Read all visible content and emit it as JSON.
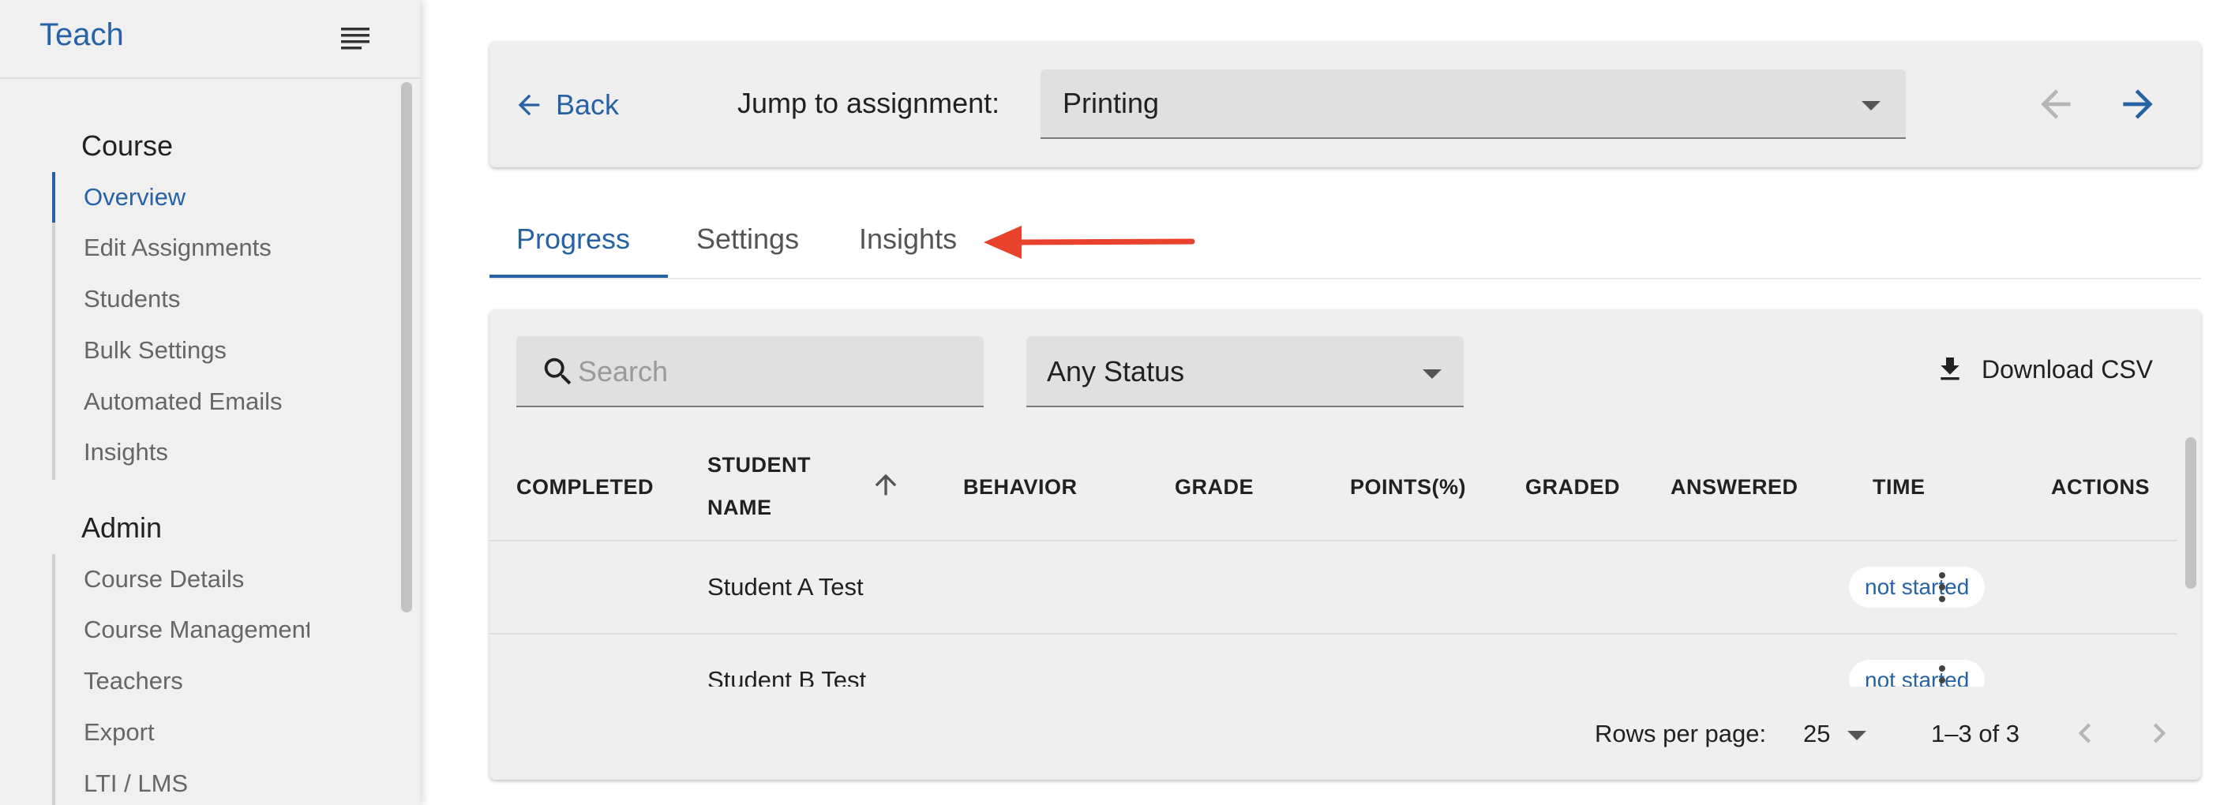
{
  "sidebar": {
    "brand": "Teach",
    "sections": [
      {
        "title": "Course",
        "items": [
          {
            "label": "Overview",
            "active": true
          },
          {
            "label": "Edit Assignments"
          },
          {
            "label": "Students"
          },
          {
            "label": "Bulk Settings"
          },
          {
            "label": "Automated Emails"
          },
          {
            "label": "Insights"
          }
        ]
      },
      {
        "title": "Admin",
        "items": [
          {
            "label": "Course Details"
          },
          {
            "label": "Course Management"
          },
          {
            "label": "Teachers"
          },
          {
            "label": "Export"
          },
          {
            "label": "LTI / LMS"
          }
        ]
      }
    ]
  },
  "topbar": {
    "back_label": "Back",
    "jump_label": "Jump to assignment:",
    "assignment_selected": "Printing"
  },
  "tabs": [
    {
      "label": "Progress",
      "active": true
    },
    {
      "label": "Settings"
    },
    {
      "label": "Insights"
    }
  ],
  "filters": {
    "search_placeholder": "Search",
    "search_value": "",
    "status_selected": "Any Status",
    "download_label": "Download CSV"
  },
  "table": {
    "headers": {
      "completed": "COMPLETED",
      "student_line1": "STUDENT",
      "student_line2": "NAME",
      "behavior": "BEHAVIOR",
      "grade": "GRADE",
      "points": "POINTS(%)",
      "graded": "GRADED",
      "answered": "ANSWERED",
      "time": "TIME",
      "actions": "ACTIONS"
    },
    "rows": [
      {
        "student": "Student A Test",
        "status": "not started"
      },
      {
        "student": "Student B Test",
        "status": "not started"
      }
    ]
  },
  "pagination": {
    "rows_per_page_label": "Rows per page:",
    "rows_per_page": "25",
    "range": "1–3 of 3"
  },
  "colors": {
    "accent": "#2762a4",
    "annotation_arrow": "#e8412c"
  }
}
